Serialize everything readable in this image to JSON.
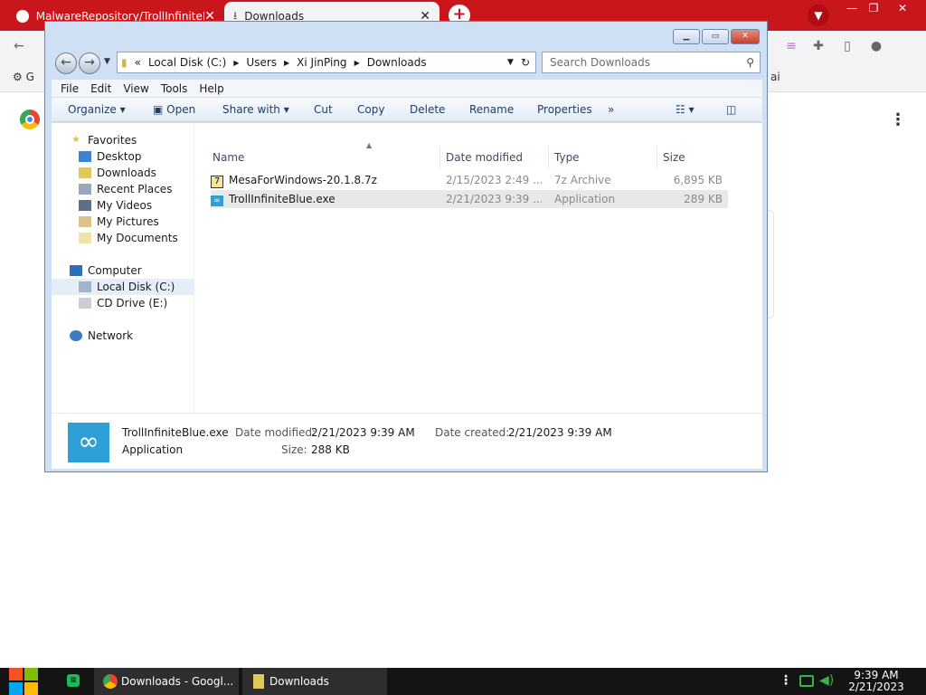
{
  "chrome": {
    "tabs": [
      {
        "title": "MalwareRepository/TrollInfiniteB"
      },
      {
        "title": "Downloads"
      }
    ],
    "new_tab": "+",
    "window_controls": [
      "—",
      "❐",
      "✕"
    ],
    "bookmarks": [
      "G",
      "ai"
    ]
  },
  "explorer": {
    "breadcrumb": {
      "prefix": "«",
      "parts": [
        "Local Disk (C:)",
        "Users",
        "Xi JinPing",
        "Downloads"
      ]
    },
    "search_placeholder": "Search Downloads",
    "menu": [
      "File",
      "Edit",
      "View",
      "Tools",
      "Help"
    ],
    "commands": {
      "organize": "Organize",
      "open": "Open",
      "share_with": "Share with",
      "cut": "Cut",
      "copy": "Copy",
      "delete": "Delete",
      "rename": "Rename",
      "properties": "Properties",
      "more": "»"
    },
    "nav": {
      "favorites": "Favorites",
      "desktop": "Desktop",
      "downloads": "Downloads",
      "recent_places": "Recent Places",
      "my_videos": "My Videos",
      "my_pictures": "My Pictures",
      "my_documents": "My Documents",
      "computer": "Computer",
      "local_disk": "Local Disk (C:)",
      "cd_drive": "CD Drive (E:)",
      "network": "Network"
    },
    "columns": {
      "name": "Name",
      "date": "Date modified",
      "type": "Type",
      "size": "Size"
    },
    "files": [
      {
        "name": "MesaForWindows-20.1.8.7z",
        "date": "2/15/2023 2:49 ...",
        "type": "7z Archive",
        "size": "6,895 KB"
      },
      {
        "name": "TrollInfiniteBlue.exe",
        "date": "2/21/2023 9:39 ...",
        "type": "Application",
        "size": "289 KB"
      }
    ],
    "details": {
      "name": "TrollInfiniteBlue.exe",
      "type": "Application",
      "date_modified_label": "Date modified:",
      "date_modified": "2/21/2023 9:39 AM",
      "date_created_label": "Date created:",
      "date_created": "2/21/2023 9:39 AM",
      "size_label": "Size:",
      "size": "288 KB"
    }
  },
  "taskbar": {
    "items": [
      {
        "label": "Downloads - Googl..."
      },
      {
        "label": "Downloads"
      }
    ],
    "clock_time": "9:39 AM",
    "clock_date": "2/21/2023"
  }
}
